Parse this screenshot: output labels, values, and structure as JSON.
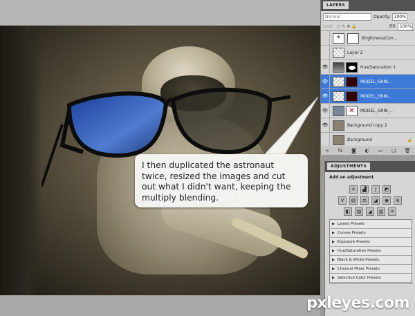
{
  "layers_panel": {
    "tab": "LAYERS",
    "blend_mode": "Normal",
    "opacity_label": "Opacity:",
    "opacity_value": "100%",
    "lock_label": "Lock:",
    "fill_label": "Fill:",
    "fill_value": "100%",
    "layers": [
      {
        "name": "Brightness/Con...",
        "visible": false,
        "selected": false
      },
      {
        "name": "Layer 2",
        "visible": false,
        "selected": false
      },
      {
        "name": "Hue/Saturation 1",
        "visible": true,
        "selected": false
      },
      {
        "name": "MODEL_GRIN...",
        "visible": true,
        "selected": true
      },
      {
        "name": "MODEL_GRIN...",
        "visible": true,
        "selected": true
      },
      {
        "name": "MODEL_GRIN_...",
        "visible": true,
        "selected": false
      },
      {
        "name": "Background copy 2",
        "visible": true,
        "selected": false
      },
      {
        "name": "Background",
        "visible": false,
        "selected": false
      }
    ]
  },
  "adjustments_panel": {
    "tab": "ADJUSTMENTS",
    "title": "Add an adjustment",
    "presets": [
      "Levels Presets",
      "Curves Presets",
      "Exposure Presets",
      "Hue/Saturation Presets",
      "Black & White Presets",
      "Channel Mixer Presets",
      "Selective Color Presets"
    ]
  },
  "callout": {
    "text": "I then duplicated the astronaut twice, resized the images and cut out what I didn't want, keeping the multiply blending."
  },
  "watermark": "pxleyes.com",
  "colors": {
    "selected_layer": "#3d7ad8",
    "panel_bg": "#d6d6d6",
    "panel_header": "#525252"
  }
}
